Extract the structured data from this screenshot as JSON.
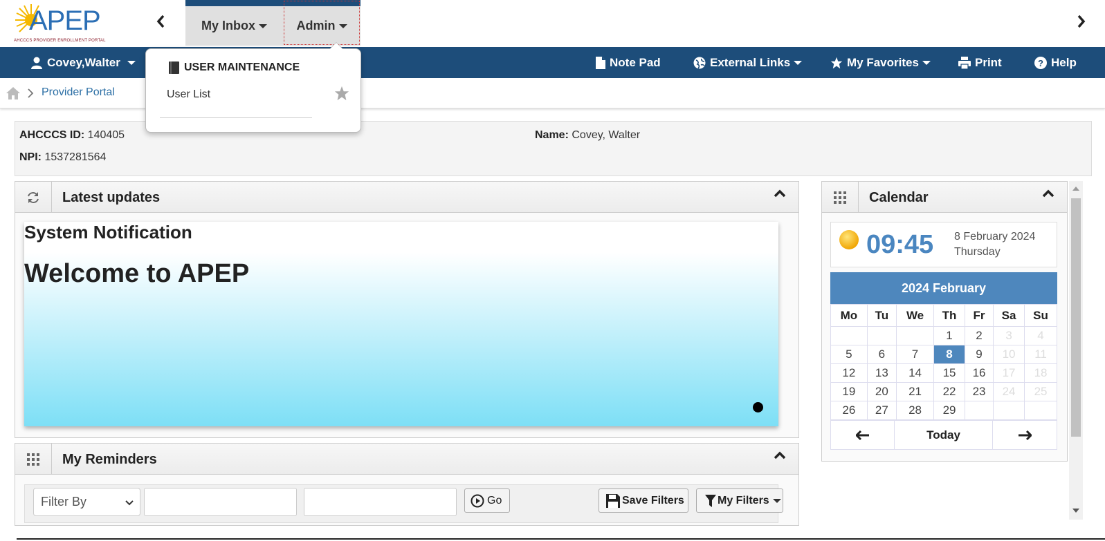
{
  "brand": {
    "logo_text": "APEP",
    "logo_subtitle": "AHCCCS PROVIDER ENROLLMENT PORTAL"
  },
  "top_tabs": [
    {
      "label": "My Inbox"
    },
    {
      "label": "Admin"
    }
  ],
  "navbar": {
    "user": "Covey,Walter",
    "note_pad": "Note Pad",
    "external_links": "External Links",
    "my_favorites": "My Favorites",
    "print": "Print",
    "help": "Help"
  },
  "breadcrumb": {
    "current": "Provider Portal"
  },
  "admin_dropdown": {
    "section": "USER MAINTENANCE",
    "items": [
      {
        "label": "User List"
      }
    ]
  },
  "provider_info": {
    "ahcccs_id_label": "AHCCCS ID:",
    "ahcccs_id": "140405",
    "npi_label": "NPI:",
    "npi": "1537281564",
    "name_label": "Name:",
    "name": "Covey, Walter"
  },
  "latest_updates": {
    "title": "Latest updates",
    "notification_title": "System Notification",
    "notification_body": "Welcome to APEP"
  },
  "reminders": {
    "title": "My Reminders",
    "filter_select": "Filter By",
    "go_label": "Go",
    "save_filters_label": "Save Filters",
    "my_filters_label": "My Filters"
  },
  "calendar": {
    "title": "Calendar",
    "time": "09:45",
    "date": "8 February 2024",
    "weekday": "Thursday",
    "month_header": "2024 February",
    "day_headers": [
      "Mo",
      "Tu",
      "We",
      "Th",
      "Fr",
      "Sa",
      "Su"
    ],
    "weeks": [
      [
        "",
        "",
        "",
        "1",
        "2",
        "3",
        "4"
      ],
      [
        "5",
        "6",
        "7",
        "8",
        "9",
        "10",
        "11"
      ],
      [
        "12",
        "13",
        "14",
        "15",
        "16",
        "17",
        "18"
      ],
      [
        "19",
        "20",
        "21",
        "22",
        "23",
        "24",
        "25"
      ],
      [
        "26",
        "27",
        "28",
        "29",
        "",
        "",
        ""
      ]
    ],
    "today_day": "8",
    "today_label": "Today"
  },
  "colors": {
    "navy": "#1d4d7a",
    "calendar_blue": "#4e87bd",
    "link": "#2c6fa5"
  }
}
